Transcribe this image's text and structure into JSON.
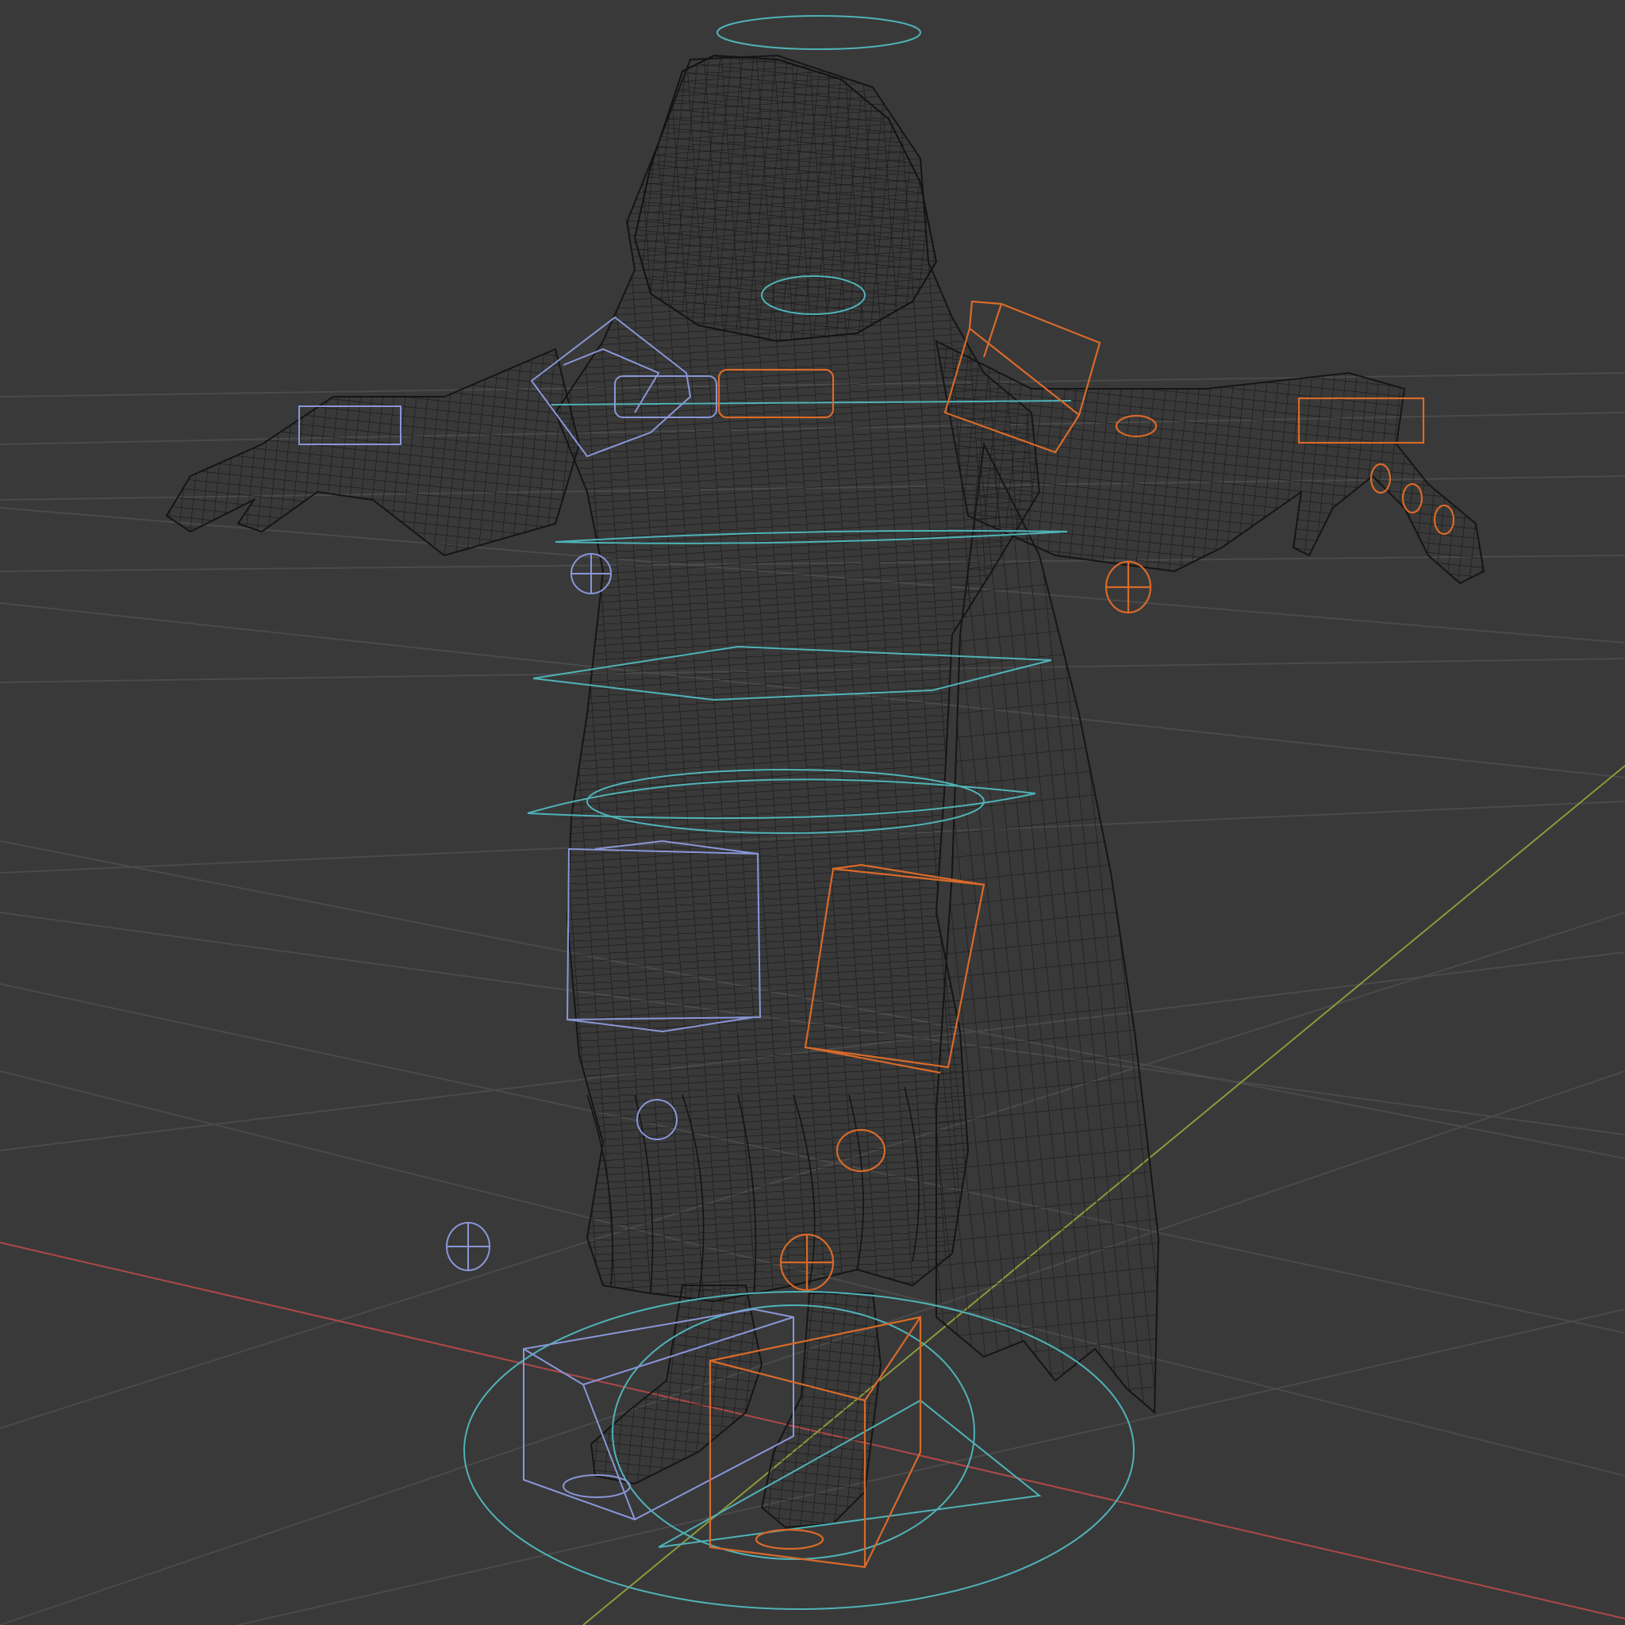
{
  "viewport": {
    "background_color": "#393939",
    "grid_color": "#4a4a4a",
    "x_axis_color": "#b04848",
    "y_axis_color": "#8a9a3a",
    "mesh_wire_color": "#141414",
    "mesh_fill_color": "#2f2f2f"
  },
  "rig": {
    "root_control_color": "#4fb3b8",
    "left_side_control_color": "#8a96d8",
    "right_side_control_color": "#d86a2a",
    "controls": [
      {
        "name": "head-halo-control",
        "side": "center",
        "shape": "circle"
      },
      {
        "name": "neck-control",
        "side": "center",
        "shape": "circle"
      },
      {
        "name": "chest-control",
        "side": "center",
        "shape": "circle"
      },
      {
        "name": "spine-control",
        "side": "center",
        "shape": "square"
      },
      {
        "name": "hips-control",
        "side": "center",
        "shape": "circle"
      },
      {
        "name": "root-control",
        "side": "center",
        "shape": "circle"
      },
      {
        "name": "shoulder-control-left",
        "side": "left",
        "shape": "cube"
      },
      {
        "name": "shoulder-control-right",
        "side": "right",
        "shape": "cube"
      },
      {
        "name": "hand-ik-control-left",
        "side": "left",
        "shape": "box"
      },
      {
        "name": "hand-ik-control-right",
        "side": "right",
        "shape": "box"
      },
      {
        "name": "elbow-pole-left",
        "side": "left",
        "shape": "sphere"
      },
      {
        "name": "elbow-pole-right",
        "side": "right",
        "shape": "sphere"
      },
      {
        "name": "thigh-control-left",
        "side": "left",
        "shape": "cube"
      },
      {
        "name": "thigh-control-right",
        "side": "right",
        "shape": "cube"
      },
      {
        "name": "knee-pole-left",
        "side": "left",
        "shape": "sphere"
      },
      {
        "name": "knee-pole-right",
        "side": "right",
        "shape": "sphere"
      },
      {
        "name": "foot-ik-control-left",
        "side": "left",
        "shape": "cube"
      },
      {
        "name": "foot-ik-control-right",
        "side": "right",
        "shape": "cube"
      }
    ]
  }
}
